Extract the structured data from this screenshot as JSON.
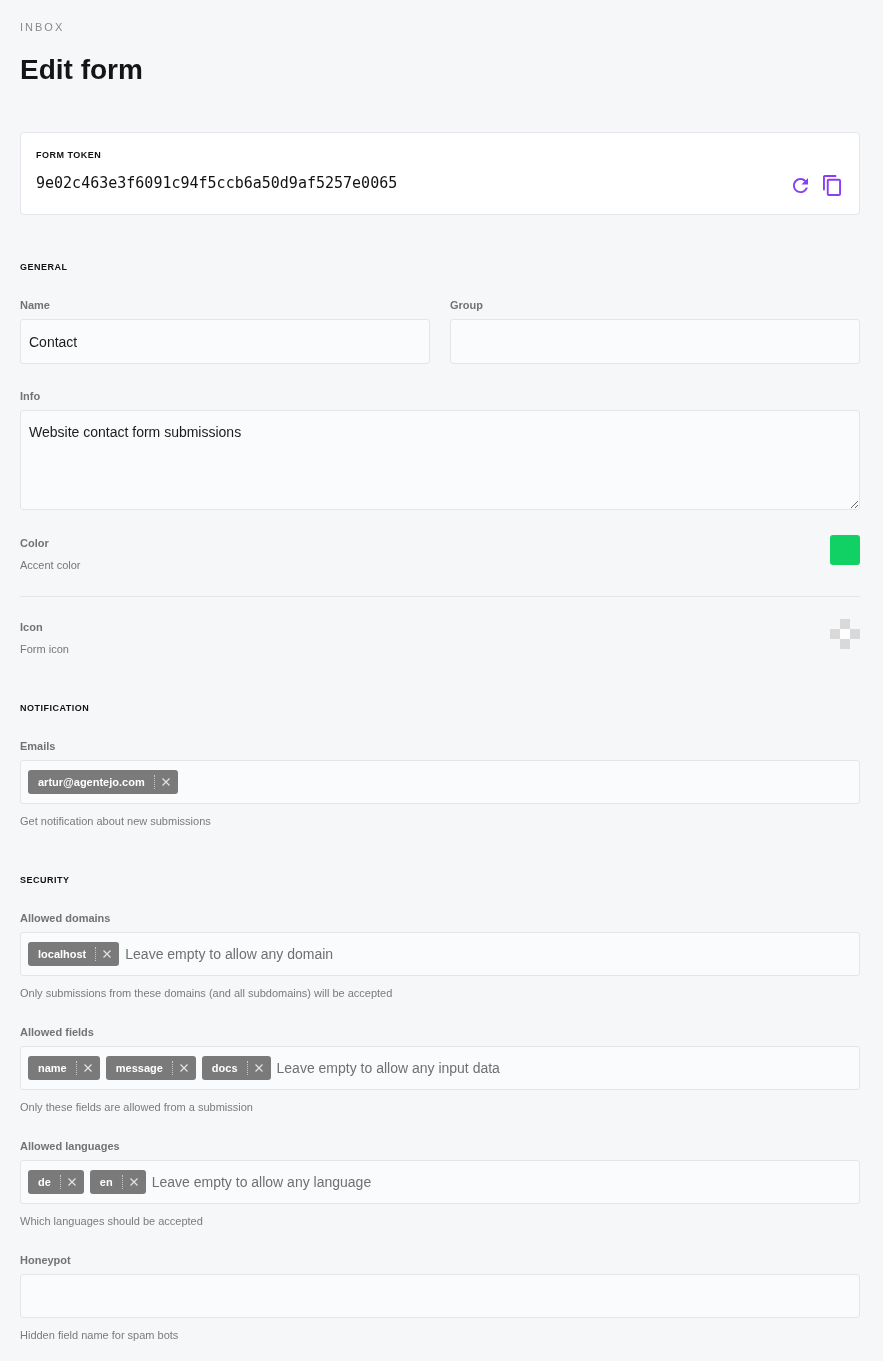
{
  "breadcrumb": "INBOX",
  "title": "Edit form",
  "token": {
    "label": "FORM TOKEN",
    "value": "9e02c463e3f6091c94f5ccb6a50d9af5257e0065"
  },
  "sections": [
    {
      "heading": "GENERAL",
      "rows": [
        {
          "kind": "columns",
          "fields": [
            {
              "label": "Name",
              "value": "Contact"
            },
            {
              "label": "Group"
            }
          ]
        },
        {
          "kind": "textarea",
          "label": "Info",
          "value": "Website contact form submissions"
        },
        {
          "kind": "color",
          "label": "Color",
          "description": "Accent color",
          "color": "#12d164"
        },
        {
          "kind": "icon",
          "label": "Icon",
          "description": "Form icon"
        }
      ]
    },
    {
      "heading": "NOTIFICATION",
      "rows": [
        {
          "kind": "tags",
          "label": "Emails",
          "tags": [
            "artur@agentejo.com"
          ],
          "hint": "Get notification about new submissions"
        }
      ]
    },
    {
      "heading": "SECURITY",
      "rows": [
        {
          "kind": "tags",
          "label": "Allowed domains",
          "tags": [
            "localhost"
          ],
          "placeholder": "Leave empty to allow any domain",
          "hint": "Only submissions from these domains (and all subdomains) will be accepted"
        },
        {
          "kind": "tags",
          "label": "Allowed fields",
          "tags": [
            "name",
            "message",
            "docs"
          ],
          "placeholder": "Leave empty to allow any input data",
          "hint": "Only these fields are allowed from a submission"
        },
        {
          "kind": "tags",
          "label": "Allowed languages",
          "tags": [
            "de",
            "en"
          ],
          "placeholder": "Leave empty to allow any language",
          "hint": "Which languages should be accepted"
        },
        {
          "kind": "text",
          "label": "Honeypot",
          "hint": "Hidden field name for spam bots"
        }
      ]
    }
  ]
}
